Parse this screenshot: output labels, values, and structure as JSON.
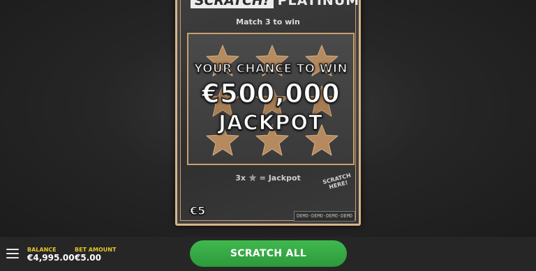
{
  "ticket": {
    "logo_scratch": "SCRATCH!",
    "logo_platinum": "PLATINUM",
    "instruction": "Match 3 to win",
    "headline_line1": "YOUR CHANCE TO WIN",
    "headline_amount": "€500,000",
    "headline_line3": "JACKPOT",
    "legend_prefix": "3x",
    "legend_suffix": "= Jackpot",
    "scratch_here_line1": "SCRATCH",
    "scratch_here_line2": "HERE!",
    "price": "€5",
    "demo_label": "DEMO-DEMO-DEMO-DEMO",
    "star_color": "#b58a5e",
    "frame_color": "#d9b48a"
  },
  "bottom_bar": {
    "balance_label": "BALANCE",
    "balance_value": "€4,995.00",
    "bet_label": "BET AMOUNT",
    "bet_value": "€5.00",
    "scratch_all_label": "SCRATCH ALL",
    "menu_icon": "hamburger-menu-icon",
    "button_color": "#36a845"
  }
}
